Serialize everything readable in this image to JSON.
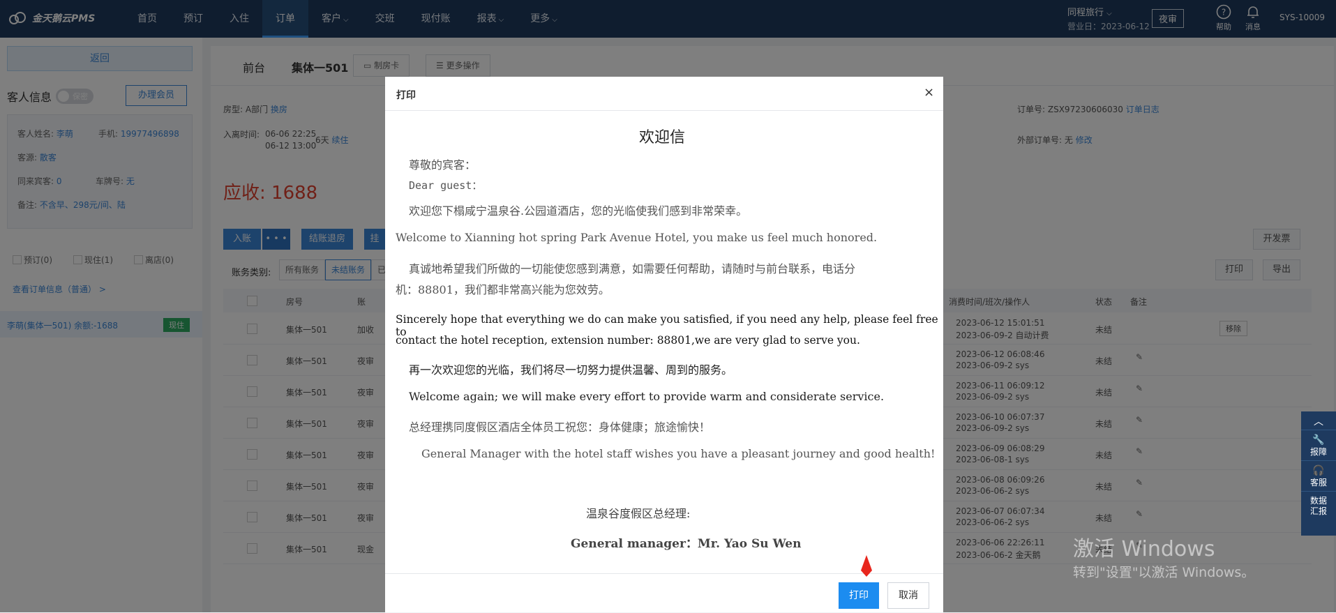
{
  "topbar": {
    "logo": "金天鹅云PMS",
    "nav": [
      "首页",
      "预订",
      "入住",
      "订单",
      "客户",
      "交班",
      "现付账",
      "报表",
      "更多"
    ],
    "nav_caret": [
      false,
      false,
      false,
      false,
      true,
      false,
      false,
      true,
      true
    ],
    "active_nav": 3,
    "org_name": "同程旅行",
    "business_date": "营业日：2023-06-12",
    "night_audit": "夜审",
    "help": "帮助",
    "message": "消息",
    "user": "SYS-10009"
  },
  "left": {
    "back": "返回",
    "guest_info_title": "客人信息",
    "secret_label": "保密",
    "member_btn": "办理会员",
    "guest_name_label": "客人姓名:",
    "guest_name": "李萌",
    "phone_label": "手机:",
    "phone": "19977496898",
    "source_label": "客源:",
    "source": "散客",
    "companions_label": "同来宾客:",
    "companions": "0",
    "plate_label": "车牌号:",
    "plate": "无",
    "remark_label": "备注:",
    "remark": "不含早、298元/间、陆",
    "status_reserve": "预订(0)",
    "status_live": "现住(1)",
    "status_left": "离店(0)",
    "order_link": "查看订单信息（普通） >",
    "guest_row": "李萌(集体一501)  余额:-1688",
    "guest_tag": "现住"
  },
  "main": {
    "tab_front": "前台",
    "tab_room": "集体一501",
    "btn_card": "制房卡",
    "btn_more": "更多操作",
    "room_type_label": "房型:",
    "room_type": "A部门",
    "change_room": "换房",
    "checkin_label": "入离时间:",
    "checkin_in": "06-06 22:25",
    "checkin_out": "06-12 13:00",
    "nights": "6天",
    "extend": "续住",
    "order_no_label": "订单号:",
    "order_no": "ZSX97230606030",
    "order_log": "订单日志",
    "ext_order_label": "外部订单号:",
    "ext_order": "无",
    "ext_modify": "修改",
    "due": "应收: 1688",
    "btn_post": "入账",
    "btn_more_dots": "• • •",
    "btn_settle": "结账退房",
    "btn_hang": "挂",
    "btn_invoice": "开发票",
    "btn_print": "打印",
    "btn_export": "导出",
    "filter_label": "账务类别:",
    "filter_all": "所有账务",
    "filter_unsettled": "未结账务",
    "filter_third": "已",
    "headers": {
      "room": "房号",
      "item": "账",
      "time": "消费时间/班次/操作人",
      "status": "状态",
      "note": "备注"
    },
    "rows": [
      {
        "room": "集体一501",
        "item": "加收",
        "t1": "2023-06-12 15:01:51",
        "t2": "2023-06-09-2 自动计费",
        "status": "未结",
        "remove": "移除"
      },
      {
        "room": "集体一501",
        "item": "夜审",
        "t1": "2023-06-12 06:08:46",
        "t2": "2023-06-09-2 sys",
        "status": "未结"
      },
      {
        "room": "集体一501",
        "item": "夜审",
        "t1": "2023-06-11 06:09:12",
        "t2": "2023-06-09-2 sys",
        "status": "未结"
      },
      {
        "room": "集体一501",
        "item": "夜审",
        "t1": "2023-06-10 06:07:37",
        "t2": "2023-06-09-2 sys",
        "status": "未结"
      },
      {
        "room": "集体一501",
        "item": "夜审",
        "t1": "2023-06-09 06:08:29",
        "t2": "2023-06-08-1 sys",
        "status": "未结"
      },
      {
        "room": "集体一501",
        "item": "夜审",
        "t1": "2023-06-08 06:09:26",
        "t2": "2023-06-06-2 sys",
        "status": "未结"
      },
      {
        "room": "集体一501",
        "item": "夜审",
        "t1": "2023-06-07 06:07:34",
        "t2": "2023-06-06-2 sys",
        "status": "未结"
      },
      {
        "room": "集体一501",
        "item": "现金",
        "t1": "2023-06-06 22:26:11",
        "t2": "2023-06-06-2 金天鹅",
        "status": "未结"
      }
    ]
  },
  "modal": {
    "title": "打印",
    "close": "×",
    "letter_title": "欢迎信",
    "greeting_cn": "尊敬的宾客：",
    "greeting_en": "Dear guest：",
    "p1_cn": "欢迎您下榻咸宁温泉谷.公园道酒店，您的光临使我们感到非常荣幸。",
    "p1_en": "Welcome to Xianning hot spring Park Avenue Hotel, you make us feel much honored.",
    "p2_cn_1": "真诚地希望我们所做的一切能使您感到满意，如需要任何帮助，请随时与前台联系，电话分",
    "p2_cn_2": "机：88801，我们都非常高兴能为您效劳。",
    "p2_en_1": "Sincerely hope that everything we do can make you satisfied, if you need any help, please feel free to",
    "p2_en_2": "contact the hotel reception, extension number: 88801,we are very glad to serve you.",
    "p3_cn": "再一次欢迎您的光临，我们将尽一切努力提供温馨、周到的服务。",
    "p3_en": "Welcome again; we will make every effort to provide warm    and considerate service.",
    "p4_cn": "总经理携同度假区酒店全体员工祝您：身体健康；旅途愉快！",
    "p4_en": "General Manager with the hotel staff wishes you    have a pleasant journey and good health!",
    "sign_cn": "温泉谷度假区总经理:",
    "sign_en": "General manager：Mr. Yao Su Wen",
    "btn_print": "打印",
    "btn_cancel": "取消"
  },
  "float_bar": {
    "report": "报障",
    "service": "客服",
    "data": "数据汇报"
  },
  "watermark": {
    "line1": "激活 Windows",
    "line2": "转到\"设置\"以激活 Windows。"
  },
  "colors": {
    "nav_bg": "#1e3a5f",
    "accent": "#3b86d8",
    "due": "#e0412e",
    "print_btn": "#1c8cf0"
  }
}
